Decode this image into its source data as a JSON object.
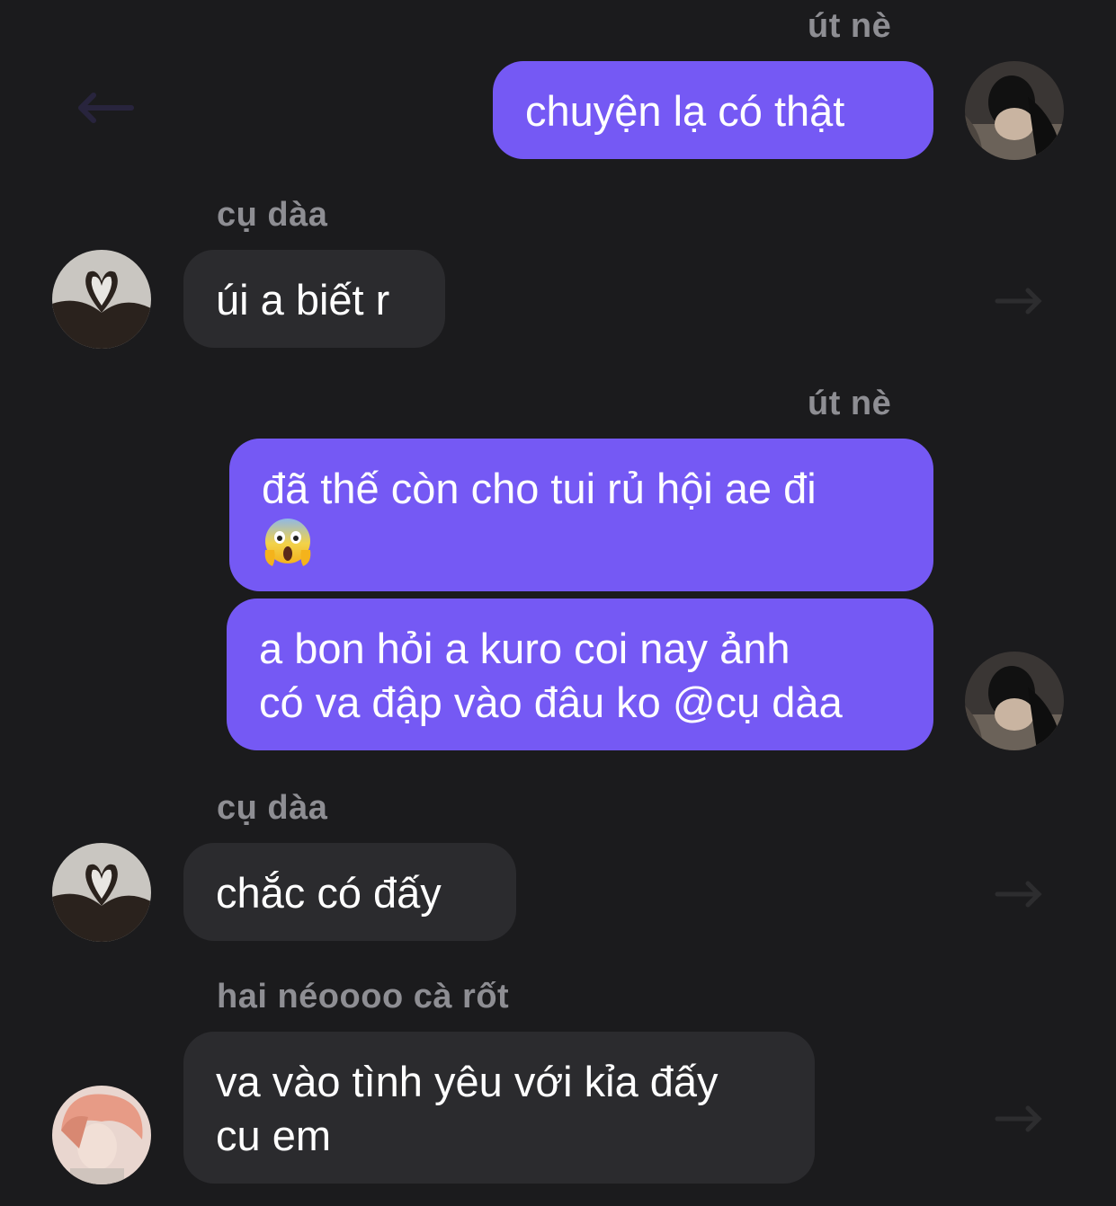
{
  "theme": {
    "background": "#1b1b1d",
    "outgoing_bubble": "#7559f4",
    "incoming_bubble": "#2b2b2e",
    "sender_name_color": "#8e8e93",
    "text_color": "#ffffff"
  },
  "messages": [
    {
      "sender": "út nè",
      "direction": "outgoing",
      "lines": [
        "chuyện lạ có thật"
      ]
    },
    {
      "sender": "cụ dàa",
      "direction": "incoming",
      "lines": [
        "úi a biết r"
      ]
    },
    {
      "sender": "út nè",
      "direction": "outgoing",
      "lines": [
        "đã thế còn cho tui rủ hội ae đi"
      ],
      "emoji": "face-screaming-in-fear"
    },
    {
      "direction": "outgoing",
      "lines": [
        "a bon hỏi a kuro coi nay ảnh",
        "có va đập vào đâu ko @cụ dàa"
      ]
    },
    {
      "sender": "cụ dàa",
      "direction": "incoming",
      "lines": [
        "chắc có đấy"
      ]
    },
    {
      "sender": "hai néoooo cà rốt",
      "direction": "incoming",
      "lines": [
        "va vào tình yêu với kỉa đấy",
        "cu em"
      ]
    }
  ],
  "icons": {
    "back": "arrow-left-icon",
    "reply": "reply-arrow-icon"
  }
}
